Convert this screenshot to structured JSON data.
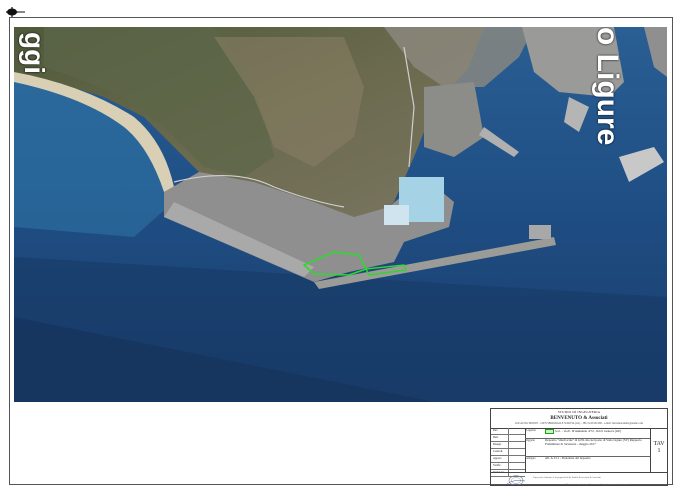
{
  "map": {
    "label_left": "ggi",
    "label_right": "o Ligure",
    "highlight_color": "#2fd82f"
  },
  "titleblock": {
    "studio": "STUDIO DI INGEGNERIA",
    "firm": "BENVENUTO & Associati",
    "address": "LOCALITA' MONTE - 12079 SERRAVALLE SCRIVIA (AL) - TEL 0143 000 000 - e-mail: benvenutostudio@studio.com",
    "revisions": [
      "Rev.",
      "Data",
      "Disegn.",
      "Controll.",
      "Approv.",
      "Verific.",
      "Revisione"
    ],
    "row_legend_key": "Legenda",
    "row_legend_value": "S.r.l. - via E. D'Annunzio 4/72, 16121 Genova (GE)",
    "row_oggetto_key": "Oggetto",
    "row_oggetto_value": "Deposito \"small scale\" di GNL sito nel porto di Vado Ligure (SV) Rapporto Preliminare di Sicurezza - maggio 2017",
    "row_allegato_key": "Allegato",
    "row_allegato_value": "All. A.13.1 - Posizione del deposito",
    "tav_label": "TAV",
    "tav_number": "1",
    "footer_note": "Il presente elaborato è di proprietà dello Studio Benvenuto & Associati"
  },
  "bottom_note": "E' vietata la riproduzione del presente elaborato senza autorizzazione scritta"
}
